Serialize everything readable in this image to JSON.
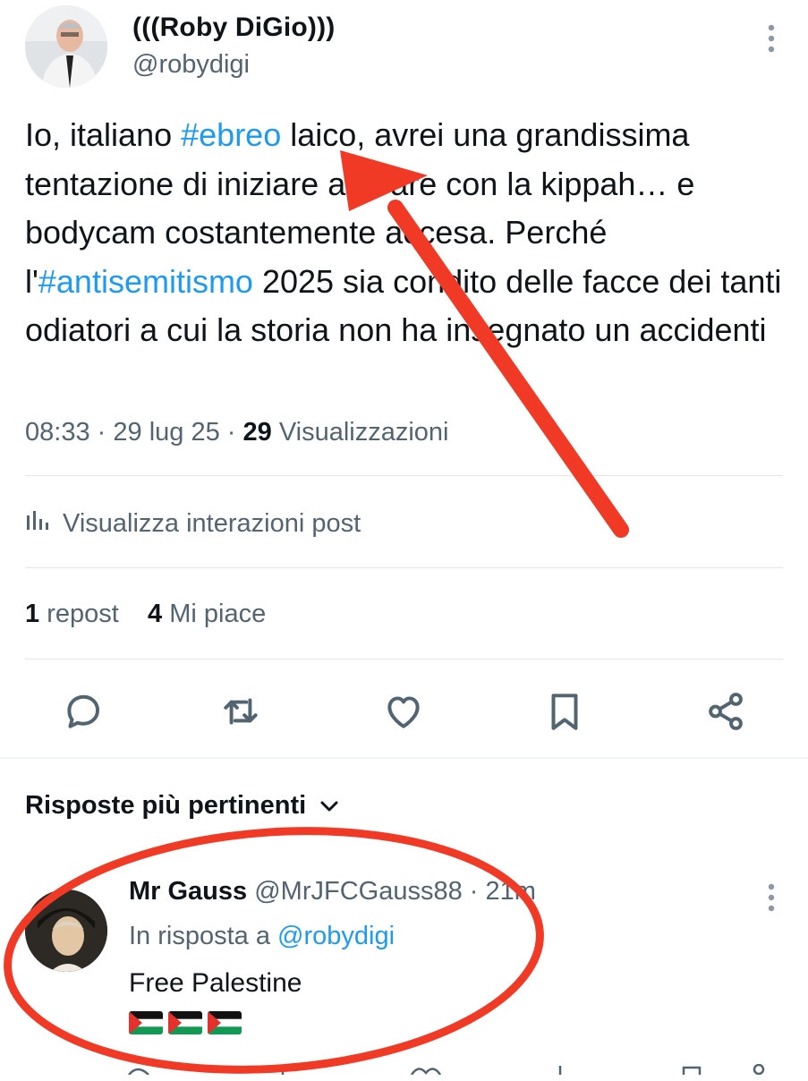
{
  "post": {
    "author": {
      "display_name": "(((Roby DiGio)))",
      "handle": "@robydigi"
    },
    "text_parts": {
      "p1": "Io, italiano ",
      "tag1": "#ebreo",
      "p2": " laico, avrei una grandissima tentazione di iniziare a girare con la kippah… e bodycam costantemente accesa. Perché l'",
      "tag2": "#antisemitismo",
      "p3": " 2025 sia condito delle facce dei tanti odiatori a cui la storia non ha insegnato un accidenti"
    },
    "time": "08:33",
    "date": "29 lug 25",
    "views_count": "29",
    "views_label": "Visualizzazioni",
    "sep": "·",
    "analytics_label": "Visualizza interazioni post",
    "reposts_count": "1",
    "reposts_label": "repost",
    "likes_count": "4",
    "likes_label": "Mi piace"
  },
  "actions": [
    {
      "icon": "reply-icon"
    },
    {
      "icon": "repost-icon"
    },
    {
      "icon": "like-icon"
    },
    {
      "icon": "bookmark-icon"
    },
    {
      "icon": "share-icon"
    }
  ],
  "replies": {
    "heading": "Risposte più pertinenti",
    "items": [
      {
        "display_name": "Mr Gauss",
        "handle": "@MrJFCGauss88",
        "sep": "·",
        "age": "21m",
        "reply_to_label": "In risposta a",
        "reply_to_handle": "@robydigi",
        "text": "Free Palestine",
        "flags": [
          "palestine-flag",
          "palestine-flag",
          "palestine-flag"
        ]
      }
    ]
  },
  "colors": {
    "link": "#1d9bf0",
    "muted": "#536471",
    "annotation": "#f03a26"
  }
}
